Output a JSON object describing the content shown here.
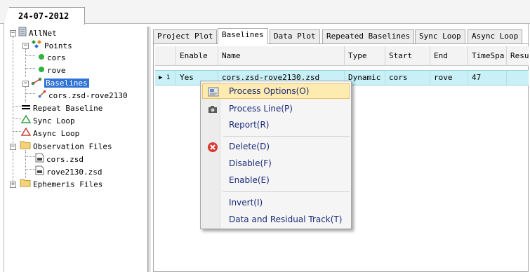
{
  "date_tab": "24-07-2012",
  "tree": {
    "root": "AllNet",
    "points": "Points",
    "point_items": [
      "cors",
      "rove"
    ],
    "baselines": "Baselines",
    "baseline_items": [
      "cors.zsd-rove2130"
    ],
    "repeat_baseline": "Repeat Baseline",
    "sync_loop": "Sync Loop",
    "async_loop": "Async Loop",
    "observation_files": "Observation Files",
    "observation_items": [
      "cors.zsd",
      "rove2130.zsd"
    ],
    "ephemeris_files": "Ephemeris Files"
  },
  "tabs": [
    "Project Plot",
    "Baselines",
    "Data Plot",
    "Repeated Baselines",
    "Sync Loop",
    "Async Loop"
  ],
  "active_tab": "Baselines",
  "grid": {
    "columns": [
      "Enable",
      "Name",
      "Type",
      "Start",
      "End",
      "TimeSpa",
      "Resu"
    ],
    "rows": [
      {
        "num": "1",
        "enable": "Yes",
        "name": "cors.zsd-rove2130.zsd",
        "type": "Dynamic",
        "start": "cors",
        "end": "rove",
        "timespan": "47",
        "result": ""
      }
    ]
  },
  "context_menu": {
    "items": [
      "Process Options(O)",
      "Process Line(P)",
      "Report(R)",
      "Delete(D)",
      "Disable(F)",
      "Enable(E)",
      "Invert(I)",
      "Data and Residual Track(T)"
    ],
    "highlighted": "Process Options(O)"
  },
  "colors": {
    "selection_blue": "#3173d4",
    "row_highlight": "#c8f0f6",
    "menu_hover": "#fdebb0",
    "menu_text": "#1a2a7a",
    "delete_red": "#d83a32"
  }
}
